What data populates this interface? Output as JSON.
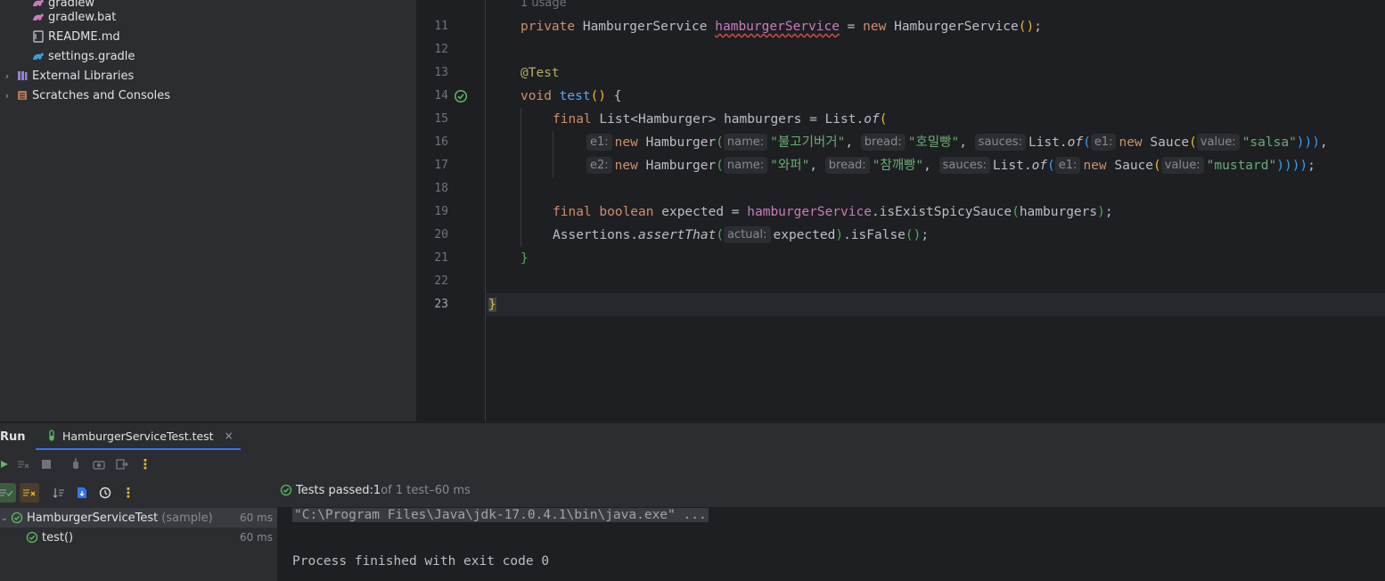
{
  "project_tree": {
    "items": [
      {
        "label": "gradlew",
        "icon": "gradle-icon"
      },
      {
        "label": "gradlew.bat",
        "icon": "gradle-icon"
      },
      {
        "label": "README.md",
        "icon": "markdown-file-icon"
      },
      {
        "label": "settings.gradle",
        "icon": "gradle-icon"
      },
      {
        "label": "External Libraries",
        "icon": "libraries-icon"
      },
      {
        "label": "Scratches and Consoles",
        "icon": "scratches-icon"
      }
    ]
  },
  "editor": {
    "usage_hint": "1 usage",
    "line_numbers": [
      "11",
      "12",
      "13",
      "14",
      "15",
      "16",
      "17",
      "18",
      "19",
      "20",
      "21",
      "22",
      "23"
    ],
    "current_line": "23",
    "code": {
      "l11": {
        "kw_private": "private",
        "type": "HamburgerService",
        "field": "hamburgerService",
        "eq": " = ",
        "kw_new": "new",
        "ctor": "HamburgerService",
        "lp": "(",
        "rp": ")",
        "semi": ";"
      },
      "l13": {
        "annotation": "@Test"
      },
      "l14": {
        "kw_void": "void",
        "method": "test",
        "parens": "()",
        "brace": " {"
      },
      "l15": {
        "kw_final": "final",
        "type": "List<Hamburger>",
        "var": " hamburgers = List.",
        "of": "of",
        "lp": "("
      },
      "l16": {
        "hint_e1": "e1:",
        "kw_new": "new",
        "ctor": " Hamburger",
        "lp": "(",
        "hint_name": "name:",
        "name": "\"불고기버거\"",
        "c1": ", ",
        "hint_bread": "bread:",
        "bread": "\"호밀빵\"",
        "c2": ", ",
        "hint_sauces": "sauces:",
        "list": "List.",
        "of": "of",
        "lp2": "(",
        "hint_e1b": "e1:",
        "kw_new2": "new",
        "sauce": " Sauce",
        "lp3": "(",
        "hint_value": "value:",
        "value": "\"salsa\"",
        "closers": ")))",
        "end": ","
      },
      "l17": {
        "hint_e2": "e2:",
        "kw_new": "new",
        "ctor": " Hamburger",
        "lp": "(",
        "hint_name": "name:",
        "name": "\"와퍼\"",
        "c1": ", ",
        "hint_bread": "bread:",
        "bread": "\"참깨빵\"",
        "c2": ", ",
        "hint_sauces": "sauces:",
        "list": "List.",
        "of": "of",
        "lp2": "(",
        "hint_e1": "e1:",
        "kw_new2": "new",
        "sauce": " Sauce",
        "lp3": "(",
        "hint_value": "value:",
        "value": "\"mustard\"",
        "closers": "))))",
        "end": ";"
      },
      "l19": {
        "kw_final": "final",
        "kw_boolean": "boolean",
        "var": " expected = ",
        "field": "hamburgerService",
        "call": ".isExistSpicySauce",
        "lp": "(",
        "arg": "hamburgers",
        "rp": ")",
        "semi": ";"
      },
      "l20": {
        "cls": "Assertions.",
        "method": "assertThat",
        "lp": "(",
        "hint_actual": "actual:",
        "arg": "expected",
        "rp": ")",
        "call": ".isFalse",
        "parens": "()",
        "semi": ";"
      },
      "l21": {
        "brace": "}"
      },
      "l23": {
        "brace": "}"
      }
    }
  },
  "run_window": {
    "title": "Run",
    "tab_label": "HamburgerServiceTest.test",
    "tab_close": "×",
    "status": {
      "label": "Tests passed: ",
      "passed": "1",
      "of_total": " of 1 test",
      "separator": " – ",
      "duration": "60 ms"
    },
    "test_tree": [
      {
        "label": "HamburgerServiceTest",
        "package": "(sample)",
        "duration": "60 ms"
      },
      {
        "label": "test()",
        "duration": "60 ms"
      }
    ],
    "console": {
      "command": "\"C:\\Program Files\\Java\\jdk-17.0.4.1\\bin\\java.exe\" ...",
      "exit_message": "Process finished with exit code 0"
    }
  },
  "colors": {
    "accent": "#3574f0",
    "pass": "#5fb865",
    "background": "#1e1f22",
    "panel": "#2b2d30"
  }
}
